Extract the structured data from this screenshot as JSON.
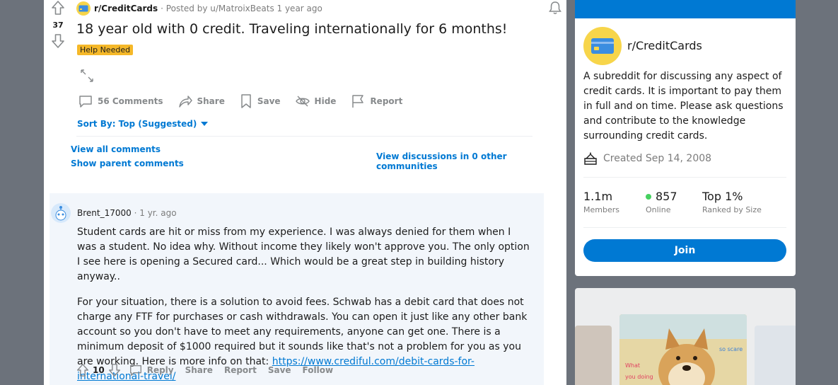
{
  "post": {
    "vote_count": "37",
    "subreddit": "r/CreditCards",
    "posted_by": "· Posted by u/MatroixBeats 1 year ago",
    "title": "18 year old with 0 credit. Traveling internationally for 6 months!",
    "flair": "Help Needed",
    "actions": {
      "comments": "56 Comments",
      "share": "Share",
      "save": "Save",
      "hide": "Hide",
      "report": "Report"
    },
    "sort_label": "Sort By: Top (Suggested)",
    "view_all": "View all comments",
    "show_parent": "Show parent comments",
    "view_discussions": "View discussions in 0 other communities"
  },
  "comment": {
    "author": "Brent_17000",
    "time": "· 1 yr. ago",
    "para1": "Student cards are hit or miss from my experience. I was always denied for them when I was a student. No idea why. Without income they likely won't approve you. The only option I see here is opening a Secured card... Which would be a great step in building history anyway..",
    "para2": "For your situation, there is a solution to avoid fees. Schwab has a debit card that does not charge any FTF for purchases or cash withdrawals. You can open it just like any other bank account so you don't have to meet any requirements, anyone can get one. There is a minimum deposit of $1000 required but it sounds like that's not a problem for you as you are working. Here is more info on that: ",
    "link": "https://www.crediful.com/debit-cards-for-international-travel/",
    "votes": "10",
    "actions": {
      "reply": "Reply",
      "share": "Share",
      "report": "Report",
      "save": "Save",
      "follow": "Follow"
    }
  },
  "sidebar": {
    "name": "r/CreditCards",
    "description": "A subreddit for discussing any aspect of credit cards. It is important to pay them in full and on time. Please ask questions and contribute to the knowledge surrounding credit cards.",
    "created": "Created Sep 14, 2008",
    "members_value": "1.1m",
    "members_label": "Members",
    "online_value": "857",
    "online_label": "Online",
    "rank_value": "Top 1%",
    "rank_label": "Ranked by Size",
    "join": "Join"
  },
  "ad": {
    "text1": "so scare",
    "text2": "What",
    "text3": "you doing"
  },
  "colors": {
    "accent": "#0079d3",
    "flair": "#f5b829",
    "online": "#46d160",
    "background": "#6c727b"
  }
}
